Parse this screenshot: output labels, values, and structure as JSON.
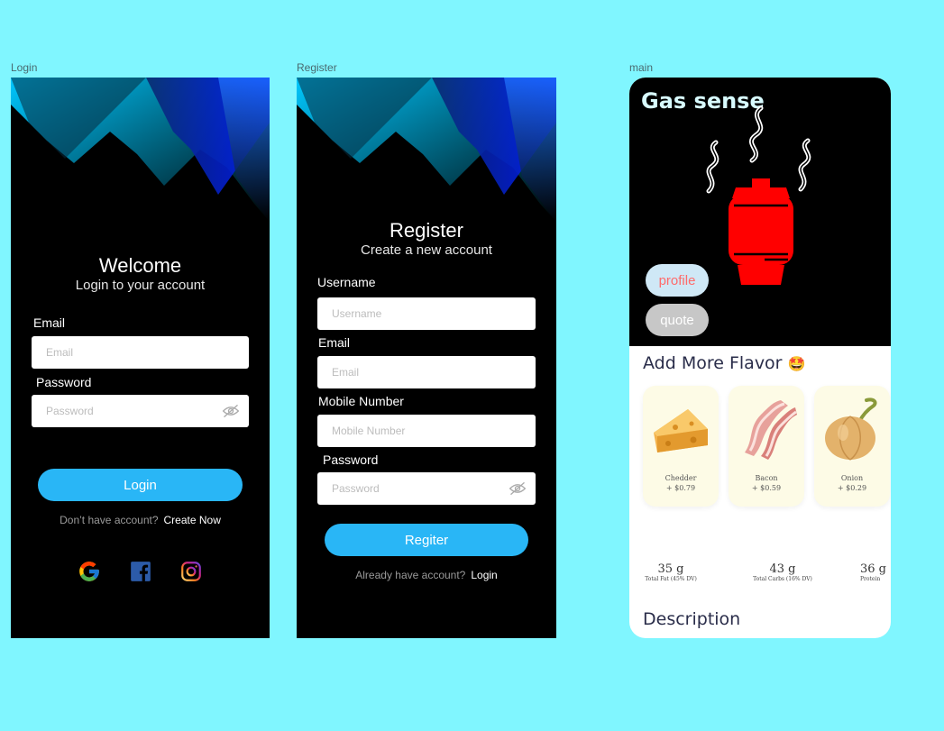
{
  "frames": {
    "login_label": "Login",
    "register_label": "Register",
    "main_label": "main"
  },
  "login": {
    "title": "Welcome",
    "subtitle": "Login to your account",
    "email_label": "Email",
    "email_placeholder": "Email",
    "password_label": "Password",
    "password_placeholder": "Password",
    "login_button": "Login",
    "no_account_text": "Don’t have account?",
    "create_link": "Create Now",
    "social_icons": [
      "google-icon",
      "facebook-icon",
      "instagram-icon"
    ]
  },
  "register": {
    "title": "Register",
    "subtitle": "Create a new account",
    "username_label": "Username",
    "username_placeholder": "Username",
    "email_label": "Email",
    "email_placeholder": "Email",
    "mobile_label": "Mobile Number",
    "mobile_placeholder": "Mobile Number",
    "password_label": "Password",
    "password_placeholder": "Password",
    "register_button": "Regiter",
    "have_account_text": "Already have account?",
    "login_link": "Login"
  },
  "main": {
    "title": "Gas sense",
    "profile_button": "profile",
    "quote_button": "quote",
    "flavor_title": "Add More Flavor",
    "flavor_emoji": "🤩",
    "items": [
      {
        "name": "Chedder",
        "price": "+ $0.79"
      },
      {
        "name": "Bacon",
        "price": "+ $0.59"
      },
      {
        "name": "Onion",
        "price": "+ $0.29"
      }
    ],
    "nutrition": [
      {
        "value": "35 g",
        "label": "Total Fat (45% DV)"
      },
      {
        "value": "43 g",
        "label": "Total Carbs (16% DV)"
      },
      {
        "value": "36 g",
        "label": "Protein"
      }
    ],
    "description_title": "Description"
  },
  "colors": {
    "background": "#80f6ff",
    "button": "#29b6f6",
    "cylinder": "#ff0000"
  }
}
